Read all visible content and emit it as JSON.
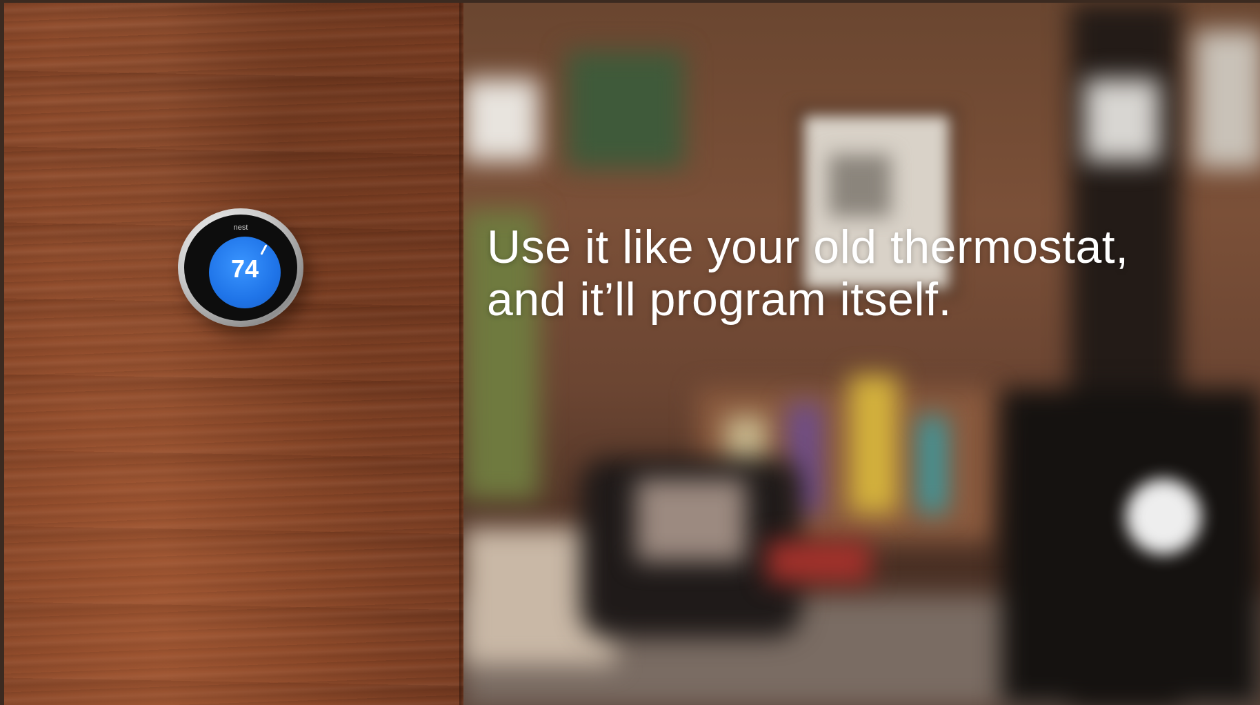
{
  "thermostat": {
    "brand": "nest",
    "temperature": "74",
    "dial_color": "#1f74e8"
  },
  "headline": {
    "line1": "Use it like your old thermostat,",
    "line2": "and it’ll program itself."
  }
}
